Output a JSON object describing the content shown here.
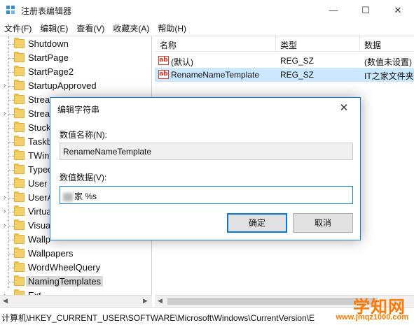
{
  "window": {
    "title": "注册表编辑器",
    "minimize": "—",
    "maximize": "☐",
    "close": "✕"
  },
  "menu": [
    "文件(F)",
    "编辑(E)",
    "查看(V)",
    "收藏夹(A)",
    "帮助(H)"
  ],
  "tree": {
    "items": [
      {
        "label": "Shutdown",
        "expandable": false
      },
      {
        "label": "StartPage",
        "expandable": false
      },
      {
        "label": "StartPage2",
        "expandable": false
      },
      {
        "label": "StartupApproved",
        "expandable": true
      },
      {
        "label": "Stream",
        "expandable": false
      },
      {
        "label": "Stream",
        "expandable": true
      },
      {
        "label": "Stuck",
        "expandable": false
      },
      {
        "label": "Taskb",
        "expandable": false
      },
      {
        "label": "TWinU",
        "expandable": false
      },
      {
        "label": "Typed",
        "expandable": false
      },
      {
        "label": "User",
        "expandable": false
      },
      {
        "label": "UserA",
        "expandable": true
      },
      {
        "label": "Virtua",
        "expandable": true
      },
      {
        "label": "Visua",
        "expandable": true
      },
      {
        "label": "Wallp",
        "expandable": false
      },
      {
        "label": "Wallpapers",
        "expandable": false
      },
      {
        "label": "WordWheelQuery",
        "expandable": false
      },
      {
        "label": "NamingTemplates",
        "expandable": false,
        "selected": true
      },
      {
        "label": "Ext",
        "expandable": true
      }
    ]
  },
  "list": {
    "headers": {
      "name": "名称",
      "type": "类型",
      "data": "数据"
    },
    "rows": [
      {
        "name": "(默认)",
        "type": "REG_SZ",
        "data": "(数值未设置)"
      },
      {
        "name": "RenameNameTemplate",
        "type": "REG_SZ",
        "data": "IT之家文件夹"
      }
    ]
  },
  "status": {
    "path": "计算机\\HKEY_CURRENT_USER\\SOFTWARE\\Microsoft\\Windows\\CurrentVersion\\E"
  },
  "dialog": {
    "title": "编辑字符串",
    "close": "✕",
    "name_label": "数值名称(N):",
    "name_value": "RenameNameTemplate",
    "data_label": "数值数据(V):",
    "data_value": "家 %s",
    "ok": "确定",
    "cancel": "取消"
  },
  "watermark": {
    "brand": "学知网",
    "url": "www.jmqz1000.com"
  }
}
